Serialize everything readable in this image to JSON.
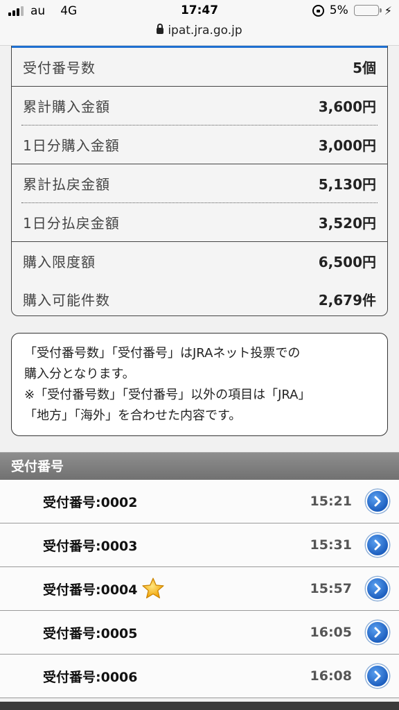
{
  "status_bar": {
    "carrier": "au",
    "network": "4G",
    "time": "17:47",
    "battery": "5%",
    "url": "ipat.jra.go.jp"
  },
  "summary": {
    "rows": [
      {
        "label": "受付番号数",
        "value": "5個"
      },
      {
        "label": "累計購入金額",
        "value": "3,600円"
      },
      {
        "label": "1日分購入金額",
        "value": "3,000円"
      },
      {
        "label": "累計払戻金額",
        "value": "5,130円"
      },
      {
        "label": "1日分払戻金額",
        "value": "3,520円"
      },
      {
        "label": "購入限度額",
        "value": "6,500円"
      },
      {
        "label": "購入可能件数",
        "value": "2,679件"
      }
    ]
  },
  "notice": {
    "line1": "「受付番号数」「受付番号」はJRAネット投票での",
    "line2": "購入分となります。",
    "line3": "※「受付番号数」「受付番号」以外の項目は「JRA」",
    "line4": "「地方」「海外」を合わせた内容です。"
  },
  "reception": {
    "header": "受付番号",
    "items": [
      {
        "number": "受付番号:0002",
        "time": "15:21",
        "starred": false
      },
      {
        "number": "受付番号:0003",
        "time": "15:31",
        "starred": false
      },
      {
        "number": "受付番号:0004",
        "time": "15:57",
        "starred": true
      },
      {
        "number": "受付番号:0005",
        "time": "16:05",
        "starred": false
      },
      {
        "number": "受付番号:0006",
        "time": "16:08",
        "starred": false
      }
    ]
  },
  "icons": {
    "arrow": "chevron-right-circle-icon",
    "star": "star-icon"
  }
}
